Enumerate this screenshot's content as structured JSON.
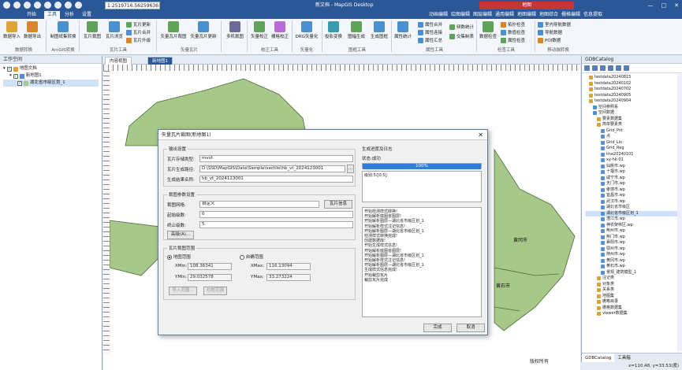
{
  "title_bar": {
    "scale_value": "1:2519716.56259636",
    "app_title": "新文档 - MapGIS Desktop",
    "context_title": "地图",
    "minimize": "—",
    "maximize": "□",
    "close": "✕"
  },
  "menu_tabs": [
    "开始",
    "工具",
    "分析",
    "设置",
    "动画编辑",
    "绘图编辑",
    "图层编辑",
    "通用编辑",
    "地图编辑",
    "地图综合",
    "栅格编辑",
    "信息提取"
  ],
  "ribbon": {
    "buttons": [
      {
        "label": "数据导入",
        "name": "data-import-button"
      },
      {
        "label": "数据导出",
        "name": "data-export-button"
      },
      {
        "label": "制图纸集转换",
        "name": "chart-convert-button"
      },
      {
        "label": "瓦片裁图",
        "name": "tile-cut-button"
      },
      {
        "label": "瓦片浏览",
        "name": "tile-browse-button"
      },
      {
        "label": "矢量瓦片裁图",
        "name": "vector-tile-cut-button"
      },
      {
        "label": "矢量瓦片更新",
        "name": "vector-tile-update-button"
      },
      {
        "label": "多机裁图",
        "name": "multi-machine-cut-button"
      },
      {
        "label": "矢量校正",
        "name": "vector-correct-button"
      },
      {
        "label": "栅格校正",
        "name": "raster-correct-button"
      },
      {
        "label": "DRG矢量化",
        "name": "drg-vectorize-button"
      },
      {
        "label": "投影变换",
        "name": "projection-button"
      },
      {
        "label": "图幅生成",
        "name": "sheet-generate-button"
      },
      {
        "label": "生成图框",
        "name": "frame-generate-button"
      },
      {
        "label": "属性统计",
        "name": "attr-stats-button"
      },
      {
        "label": "数据检查",
        "name": "data-check-button"
      }
    ],
    "small_buttons": [
      {
        "label": "瓦片更新",
        "name": "tile-update-button"
      },
      {
        "label": "瓦片合并",
        "name": "tile-merge-button"
      },
      {
        "label": "瓦片升级",
        "name": "tile-upgrade-button"
      },
      {
        "label": "属性合并",
        "name": "attr-merge-button"
      },
      {
        "label": "属性连接",
        "name": "attr-join-button"
      },
      {
        "label": "属性汇总",
        "name": "attr-summary-button"
      },
      {
        "label": "频数统计",
        "name": "freq-stats-button"
      },
      {
        "label": "交集制表",
        "name": "intersect-table-button"
      },
      {
        "label": "拓扑检查",
        "name": "topo-check-button"
      },
      {
        "label": "数值检查",
        "name": "value-check-button"
      },
      {
        "label": "属性检查",
        "name": "attr-check-button"
      },
      {
        "label": "室内导航数据",
        "name": "indoor-nav-button"
      },
      {
        "label": "导航数据",
        "name": "nav-data-button"
      },
      {
        "label": "POI数据",
        "name": "poi-data-button"
      }
    ],
    "groups": [
      "数据转换",
      "ArcGIS转换",
      "瓦片工具",
      "矢量瓦片",
      "校正工具",
      "矢量化",
      "图框工具",
      "属性工具",
      "检查工具",
      "移动端转换"
    ]
  },
  "workspace": {
    "header": "工作空间",
    "items": [
      {
        "label": "地图文档",
        "level": 0
      },
      {
        "label": "新地图1",
        "level": 1
      },
      {
        "label": "湖北省市级区划_1",
        "level": 2
      }
    ]
  },
  "doc_tabs": [
    "内容视图",
    "新地图1"
  ],
  "map_labels": {
    "huanggang": "黄冈市",
    "huangshi": "黄石市",
    "footer": "版权所有"
  },
  "gdb_panel": {
    "header": "GDBCatalog",
    "items": [
      {
        "label": "testdata20240815",
        "level": 1
      },
      {
        "label": "testdata20240102",
        "level": 1
      },
      {
        "label": "testdata20240702",
        "level": 1
      },
      {
        "label": "testdata20240905",
        "level": 1
      },
      {
        "label": "testdata20240904",
        "level": 1
      },
      {
        "label": "空间参照系",
        "level": 2
      },
      {
        "label": "空间数据",
        "level": 2
      },
      {
        "label": "要素数据集",
        "level": 3
      },
      {
        "label": "简单要素类",
        "level": 3
      },
      {
        "label": "Grid_Pnt",
        "level": 4
      },
      {
        "label": "点",
        "level": 4
      },
      {
        "label": "Grid_Lin",
        "level": 4
      },
      {
        "label": "Grid_Reg",
        "level": 4
      },
      {
        "label": "line20240101",
        "level": 4
      },
      {
        "label": "xy-hk-01",
        "level": 4
      },
      {
        "label": "仙桃市.wp",
        "level": 4
      },
      {
        "label": "十堰市.wp",
        "level": 4
      },
      {
        "label": "咸宁市.wp",
        "level": 4
      },
      {
        "label": "天门市.wp",
        "level": 4
      },
      {
        "label": "孝感市.wp",
        "level": 4
      },
      {
        "label": "宜昌市.wp",
        "level": 4
      },
      {
        "label": "武汉市.wp",
        "level": 4
      },
      {
        "label": "湖北省市级区",
        "level": 4
      },
      {
        "label": "湖北省市级区划_1",
        "level": 4,
        "selected": true
      },
      {
        "label": "潜江市.wp",
        "level": 4
      },
      {
        "label": "神农架林区.wp",
        "level": 4
      },
      {
        "label": "荆州市.wp",
        "level": 4
      },
      {
        "label": "荆门市.wp",
        "level": 4
      },
      {
        "label": "襄阳市.wp",
        "level": 4
      },
      {
        "label": "鄂州市.wp",
        "level": 4
      },
      {
        "label": "随州市.wp",
        "level": 4
      },
      {
        "label": "黄冈市.wp",
        "level": 4
      },
      {
        "label": "黄石市.wp",
        "level": 4
      },
      {
        "label": "景观_建筑模型_1",
        "level": 4
      },
      {
        "label": "注记类",
        "level": 3
      },
      {
        "label": "对象类",
        "level": 3
      },
      {
        "label": "关系类",
        "level": 3
      },
      {
        "label": "地图集",
        "level": 3
      },
      {
        "label": "栅格目录",
        "level": 3
      },
      {
        "label": "栅格数据集",
        "level": 3
      },
      {
        "label": "viewer数据集",
        "level": 3
      }
    ],
    "bottom_tabs": [
      "GDBCatalog",
      "工具箱"
    ],
    "coords": "x=110.48, y=33.53(度)"
  },
  "dialog": {
    "title": "矢量瓦片裁图(新地图1)",
    "close": "✕",
    "output_group": "输出设置",
    "tile_type_label": "瓦片存储类型:",
    "tile_type_value": "mvvt",
    "path_label": "瓦片生成路径:",
    "path_value": "D:\\SSD\\MapGIS\\Data\\Sample\\vectile\\hb_vt_2024123001",
    "result_label": "生成结果名称:",
    "result_value": "hb_vt_2024123001",
    "crop_group": "裁图参数设置",
    "grid_label": "裁图网格:",
    "grid_value": "自定义",
    "tile_info_btn": "瓦片信息",
    "start_label": "起始级数:",
    "start_value": "0",
    "end_label": "终止级数:",
    "end_value": "5",
    "advanced_btn": "高级(A)...",
    "range_group": "瓦片裁图范围",
    "radio_map": "地图范围",
    "radio_custom": "自确范围",
    "xmin_label": "XMin:",
    "xmin_value": "108.36341",
    "xmax_label": "XMax:",
    "xmax_value": "116.13094",
    "ymin_label": "YMin:",
    "ymin_value": "29.032578",
    "ymax_label": "YMax:",
    "ymax_value": "33.273224",
    "import_btn": "导入范围...",
    "draw_btn": "拉框范围",
    "log_header": "生成进度及日志",
    "status_label": "状态:",
    "status_value": "成功",
    "progress_text": "100%",
    "progress": 1.0,
    "level_text": "级别:5/[0,5];",
    "log_lines": [
      "开始检测样式转换!",
      "开始解析底图省图层!",
      "开始解析图层—湖北省市级区划_1",
      "开始解析样式注记信息!",
      "开始解析图层—湖北省市级区划_1",
      "检测样式转换完成!",
      "创建数据库!",
      "开始生成样式信息!",
      "开始解析底图省图层!",
      "开始解析图层—湖北省市级区划_1",
      "开始解析样式注记信息!",
      "开始解析图层—湖北省市级区划_1",
      "生成样式信息完成!",
      "开始裁剪瓦片",
      "裁剪瓦片完成"
    ],
    "finish_btn": "完成",
    "cancel_btn": "取消"
  }
}
